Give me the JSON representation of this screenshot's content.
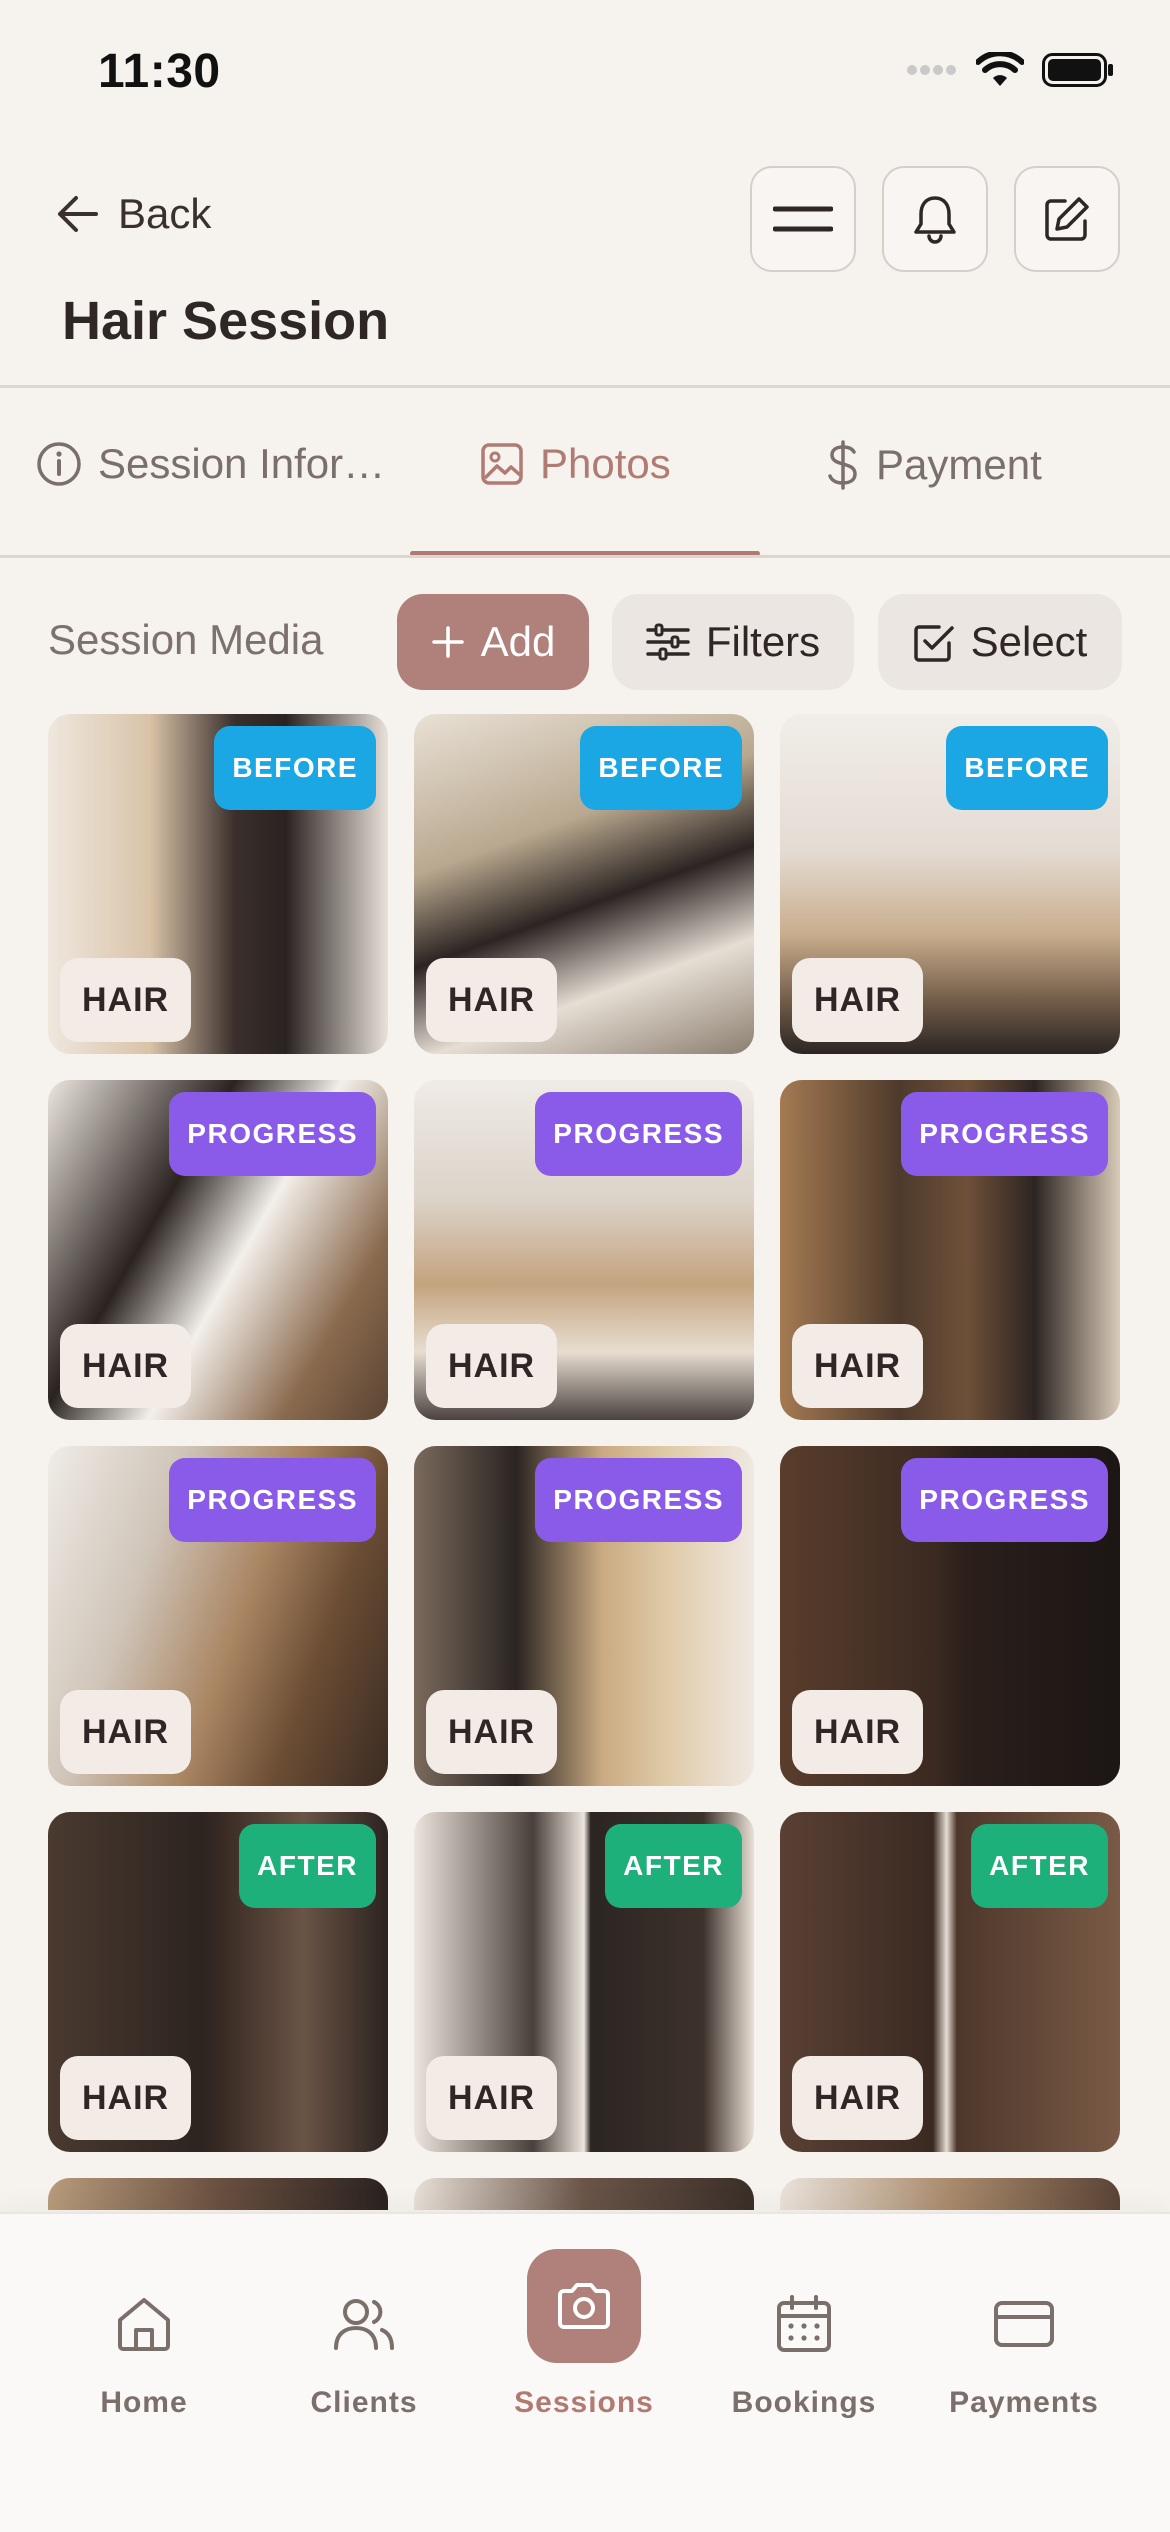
{
  "status": {
    "time": "11:30"
  },
  "header": {
    "back_label": "Back",
    "title": "Hair Session"
  },
  "tabs": [
    {
      "label": "Session Infor…",
      "icon": "info-icon",
      "active": false
    },
    {
      "label": "Photos",
      "icon": "image-icon",
      "active": true
    },
    {
      "label": "Payment",
      "icon": "dollar-icon",
      "active": false
    }
  ],
  "toolbar": {
    "section_label": "Session Media",
    "add_label": "Add",
    "filters_label": "Filters",
    "select_label": "Select"
  },
  "photos": [
    {
      "stage": "BEFORE",
      "category": "HAIR"
    },
    {
      "stage": "BEFORE",
      "category": "HAIR"
    },
    {
      "stage": "BEFORE",
      "category": "HAIR"
    },
    {
      "stage": "PROGRESS",
      "category": "HAIR"
    },
    {
      "stage": "PROGRESS",
      "category": "HAIR"
    },
    {
      "stage": "PROGRESS",
      "category": "HAIR"
    },
    {
      "stage": "PROGRESS",
      "category": "HAIR"
    },
    {
      "stage": "PROGRESS",
      "category": "HAIR"
    },
    {
      "stage": "PROGRESS",
      "category": "HAIR"
    },
    {
      "stage": "AFTER",
      "category": "HAIR"
    },
    {
      "stage": "AFTER",
      "category": "HAIR"
    },
    {
      "stage": "AFTER",
      "category": "HAIR"
    }
  ],
  "bottom_nav": [
    {
      "label": "Home",
      "icon": "home-icon",
      "active": false
    },
    {
      "label": "Clients",
      "icon": "users-icon",
      "active": false
    },
    {
      "label": "Sessions",
      "icon": "camera-icon",
      "active": true
    },
    {
      "label": "Bookings",
      "icon": "calendar-icon",
      "active": false
    },
    {
      "label": "Payments",
      "icon": "card-icon",
      "active": false
    }
  ],
  "colors": {
    "accent": "#b0817a",
    "before": "#1aa7e3",
    "progress": "#8a5ae8",
    "after": "#1eb07a"
  }
}
